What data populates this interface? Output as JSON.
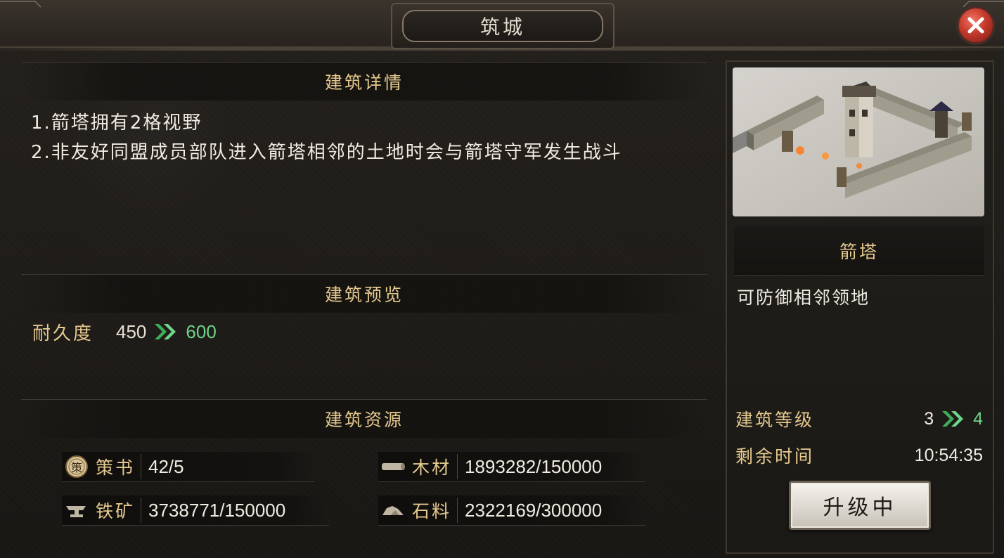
{
  "window": {
    "title": "筑城",
    "close_icon": "close-icon"
  },
  "sections": {
    "details": {
      "header": "建筑详情",
      "lines": [
        "1.箭塔拥有2格视野",
        "2.非友好同盟成员部队进入箭塔相邻的土地时会与箭塔守军发生战斗"
      ]
    },
    "preview": {
      "header": "建筑预览",
      "stat_label": "耐久度",
      "current": "450",
      "next": "600"
    },
    "resources": {
      "header": "建筑资源",
      "items": [
        {
          "icon": "strategy-book-icon",
          "icon_char": "策",
          "label": "策书",
          "value": "42/5"
        },
        {
          "icon": "wood-icon",
          "label": "木材",
          "value": "1893282/150000"
        },
        {
          "icon": "iron-ore-icon",
          "label": "铁矿",
          "value": "3738771/150000"
        },
        {
          "icon": "stone-icon",
          "label": "石料",
          "value": "2322169/300000"
        }
      ]
    }
  },
  "building": {
    "image": "arrow-tower-image",
    "name": "箭塔",
    "description": "可防御相邻领地",
    "level_label": "建筑等级",
    "level_current": "3",
    "level_next": "4",
    "time_label": "剩余时间",
    "time_value": "10:54:35",
    "upgrade_button": "升级中"
  },
  "colors": {
    "accent_gold": "#e5c98e",
    "increase_green": "#6fd58a",
    "close_red": "#c43a2c"
  }
}
